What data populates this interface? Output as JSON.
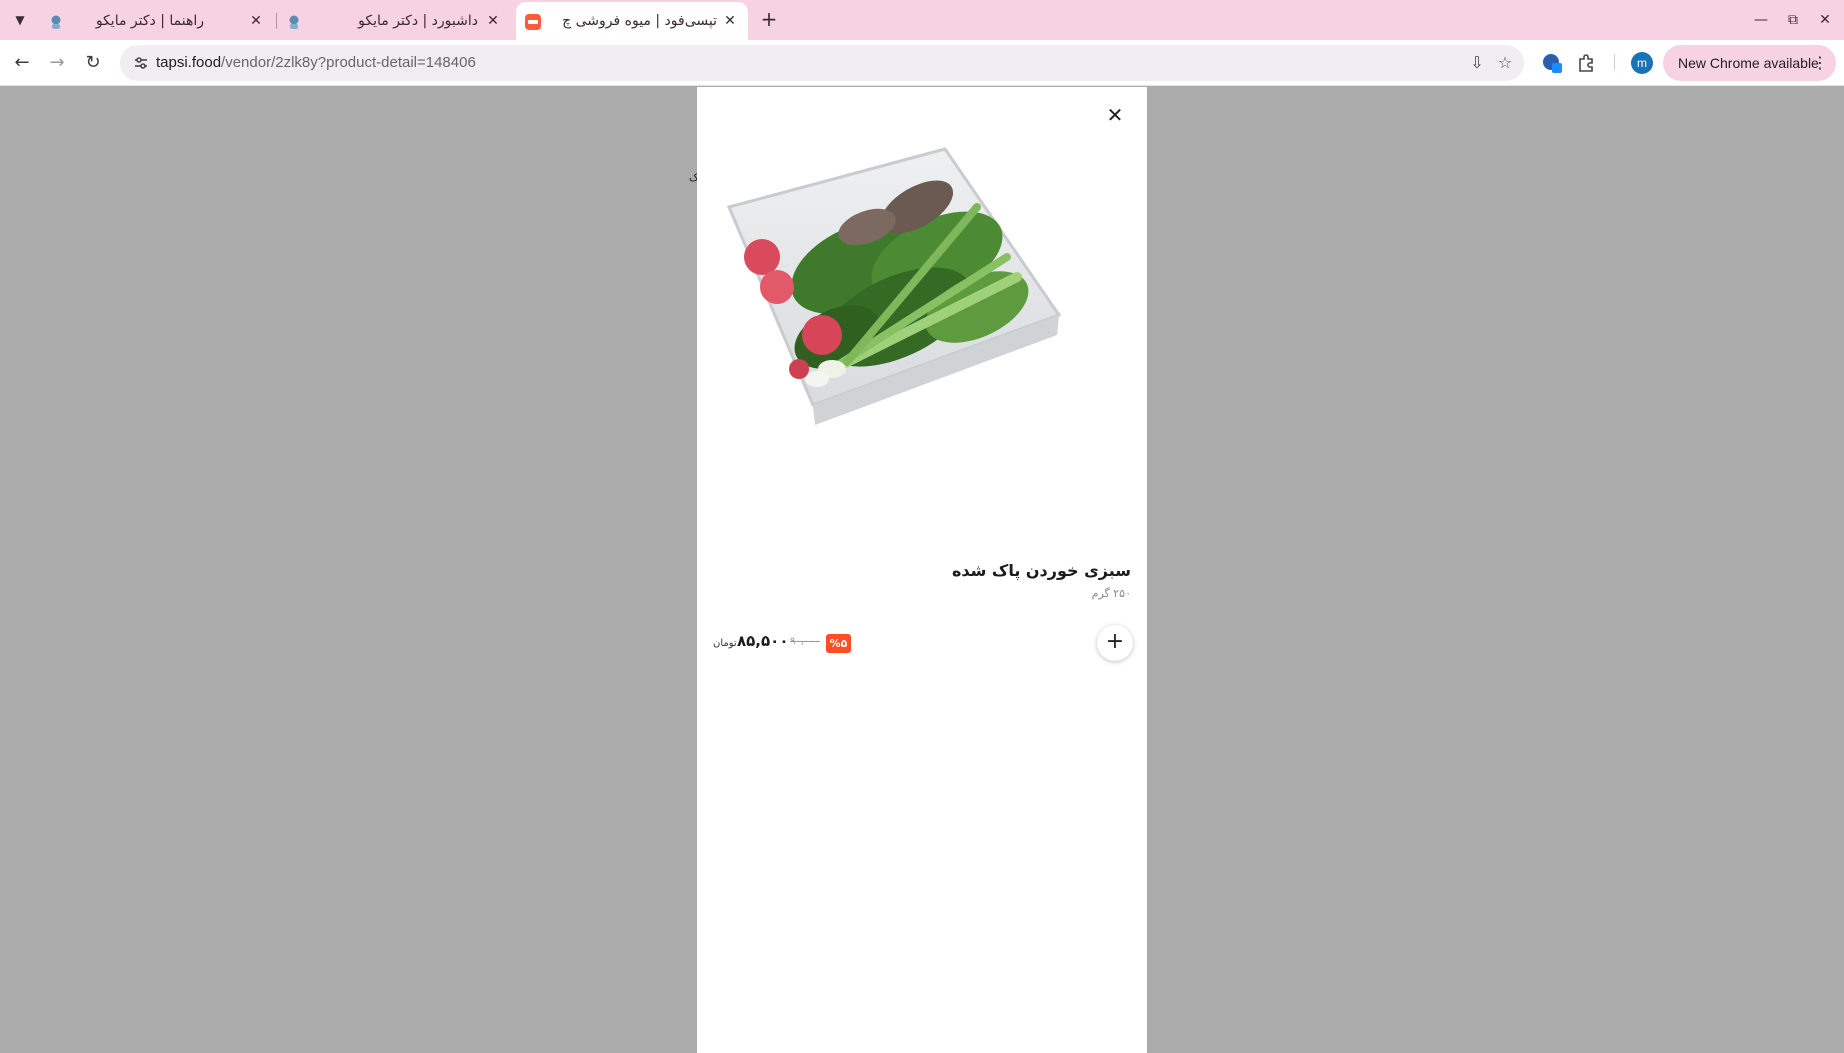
{
  "browser": {
    "tabs": [
      {
        "title": "راهنما | دکتر مایکو",
        "active": false
      },
      {
        "title": "داشبورد | دکتر مایکو",
        "active": false
      },
      {
        "title": "تپسی‌فود | میوه فروشی چ",
        "active": true
      }
    ],
    "new_tab_label": "+",
    "address": {
      "host": "tapsi.food",
      "path": "/vendor/2zlk8y?product-detail=148406"
    },
    "profile_initial": "m",
    "update_label": "New Chrome available"
  },
  "page": {
    "stray_text": "ک"
  },
  "modal": {
    "product": {
      "name": "سبزی خوردن پاک شده",
      "weight": "۲۵۰ گرم",
      "discount": "%۵",
      "old_price": "۹۰,۰۰۰",
      "new_price": "۸۵,۵۰۰",
      "currency": "تومان"
    }
  },
  "colors": {
    "tabstrip": "#f7d2e3",
    "discount_badge": "#ff4e26",
    "overlay": "#ababab"
  }
}
